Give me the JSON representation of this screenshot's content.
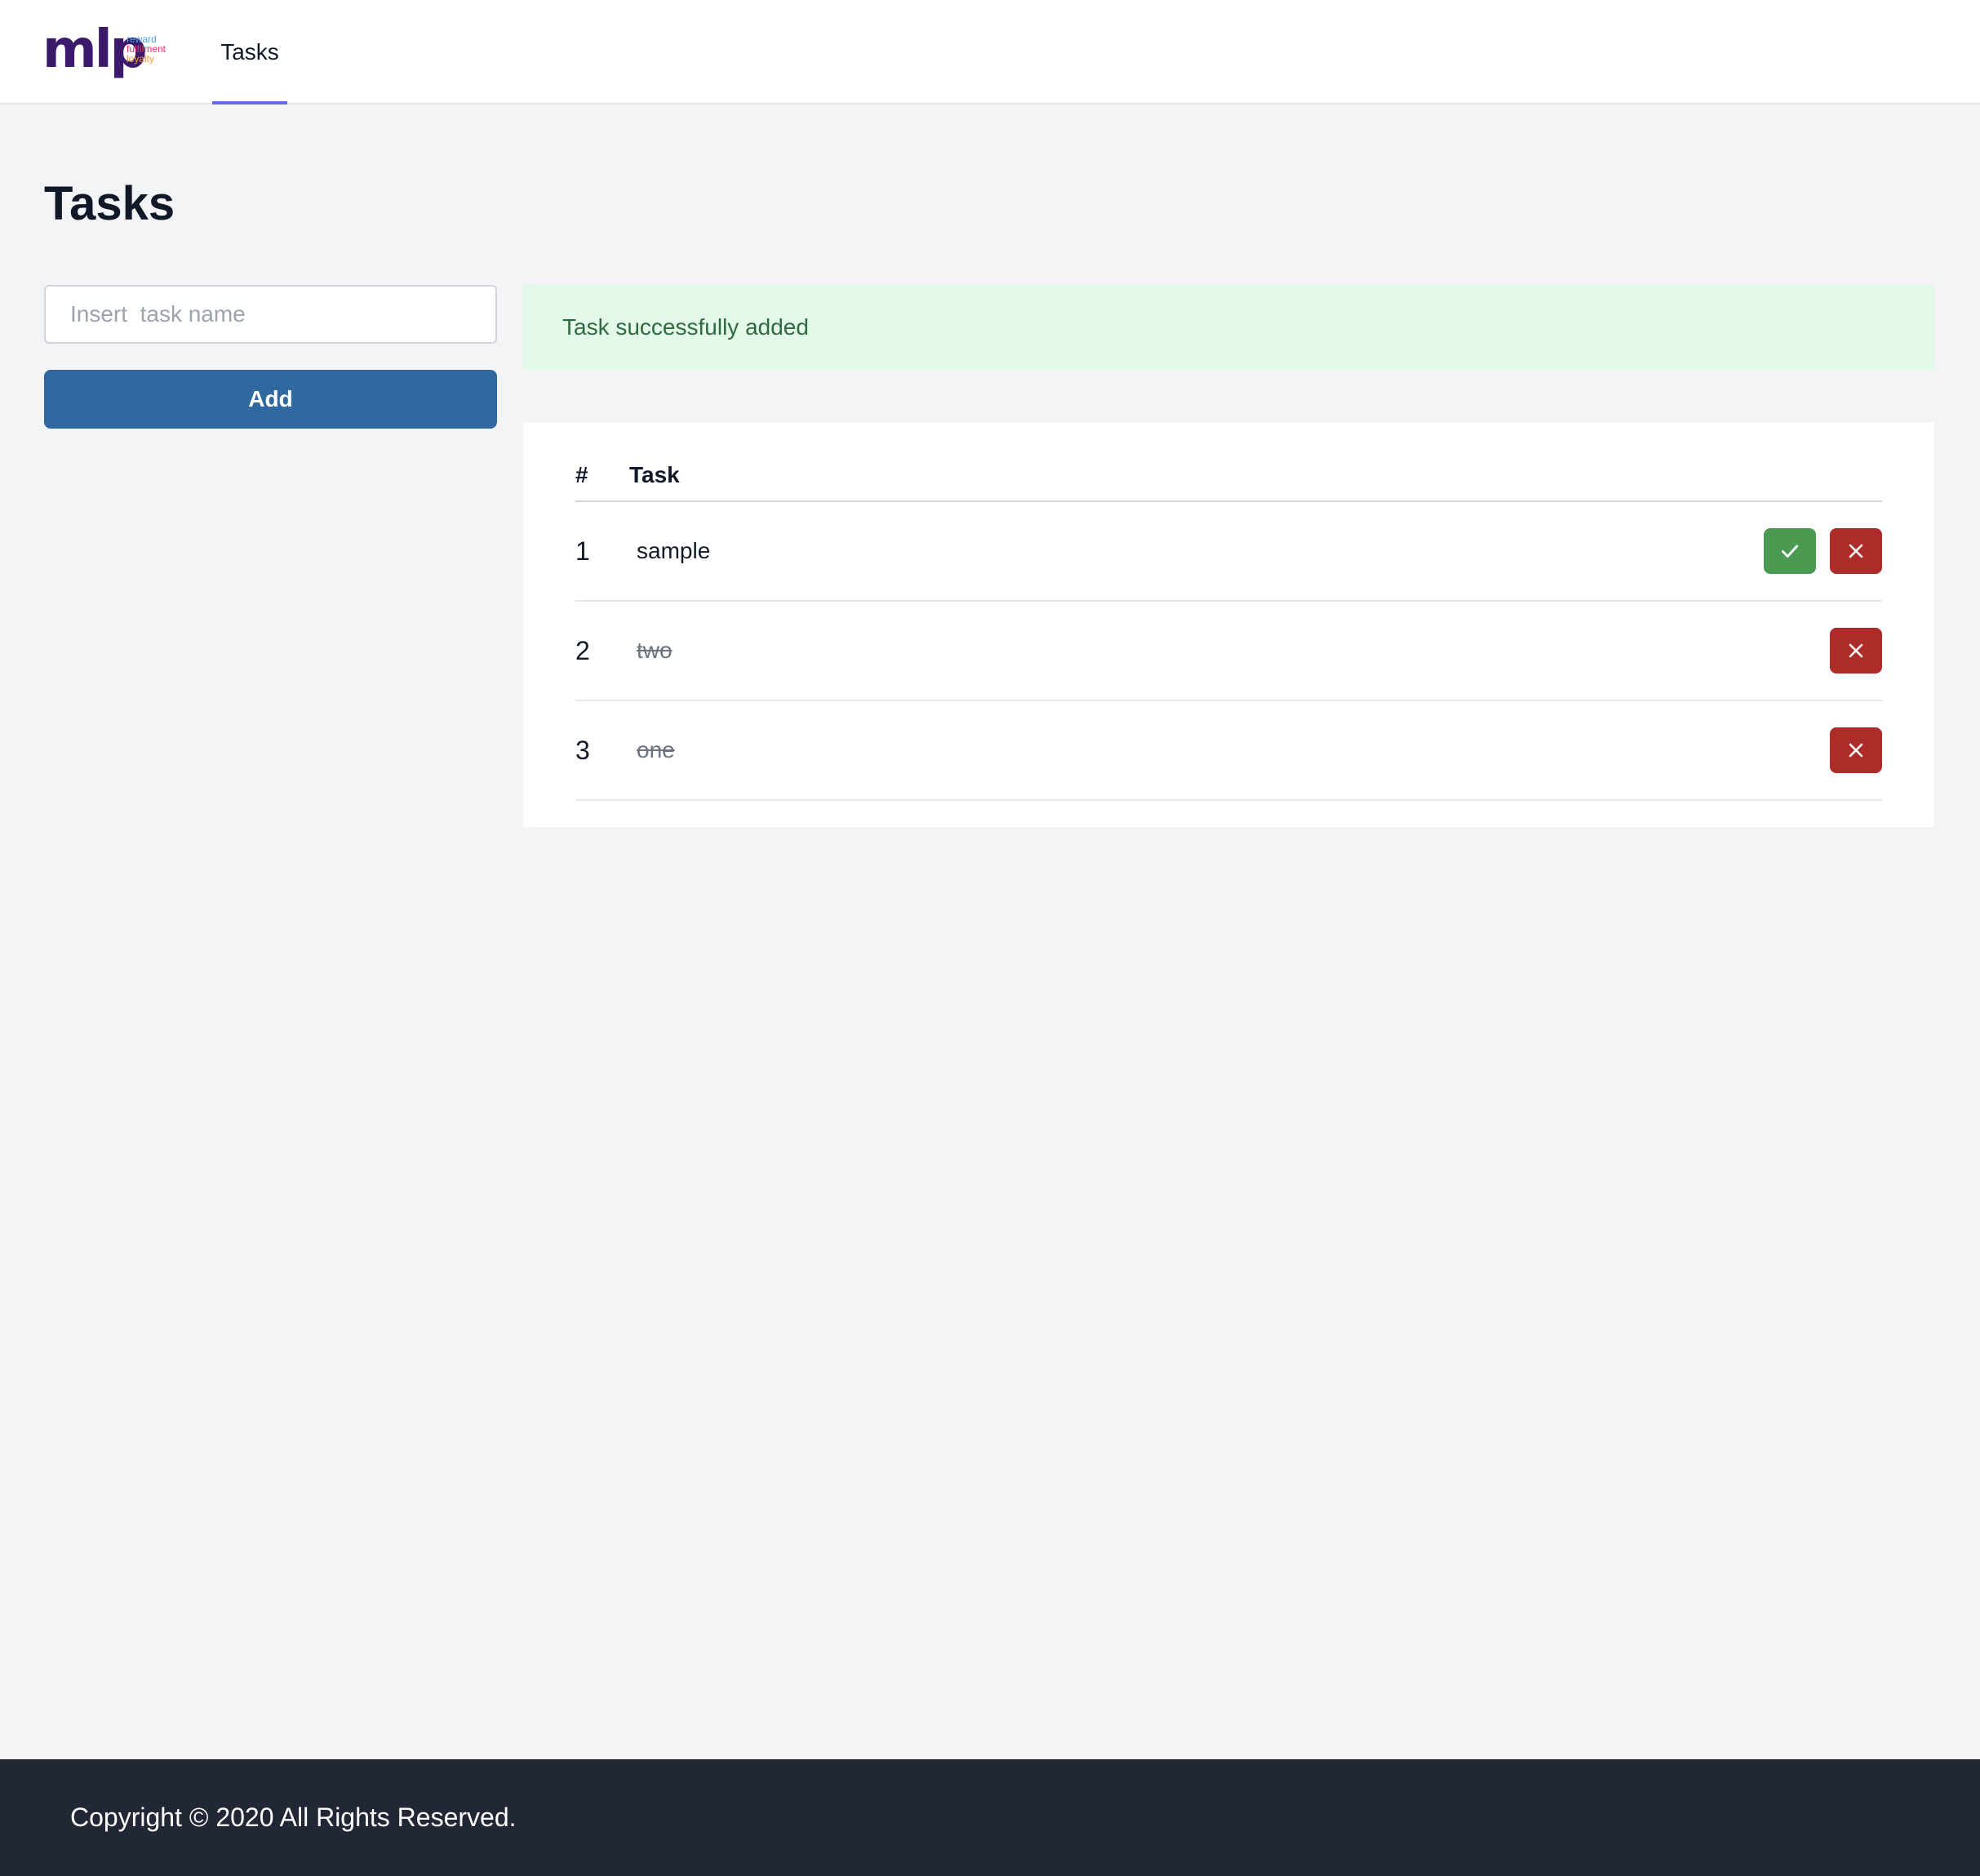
{
  "header": {
    "logo": {
      "mark": "mlp",
      "tagline": [
        "reward",
        "fulfilment",
        "loyalty"
      ],
      "tagline_colors": [
        "#4aa3df",
        "#e0356b",
        "#f39c33"
      ],
      "mark_color": "#3b1a6b"
    },
    "nav": [
      {
        "label": "Tasks",
        "active": true
      }
    ]
  },
  "page_title": "Tasks",
  "form": {
    "input_placeholder": "Insert  task name",
    "input_value": "",
    "add_label": "Add"
  },
  "alert": {
    "message": "Task successfully added",
    "type": "success"
  },
  "table": {
    "headers": [
      "#",
      "Task"
    ],
    "rows": [
      {
        "num": "1",
        "task": "sample",
        "completed": false,
        "actions": [
          "check-icon",
          "close-icon"
        ]
      },
      {
        "num": "2",
        "task": "two",
        "completed": true,
        "actions": [
          "close-icon"
        ]
      },
      {
        "num": "3",
        "task": "one",
        "completed": true,
        "actions": [
          "close-icon"
        ]
      }
    ]
  },
  "footer": {
    "text": "Copyright © 2020 All Rights Reserved."
  },
  "colors": {
    "accent": "#6366f1",
    "primary_button": "#2f699f",
    "success_bg": "#e3f9ea",
    "success_text": "#2f6b3f",
    "complete_button": "#4a9a52",
    "delete_button": "#ad2b28",
    "footer_bg": "#222735",
    "page_bg": "#f3f4f6"
  }
}
